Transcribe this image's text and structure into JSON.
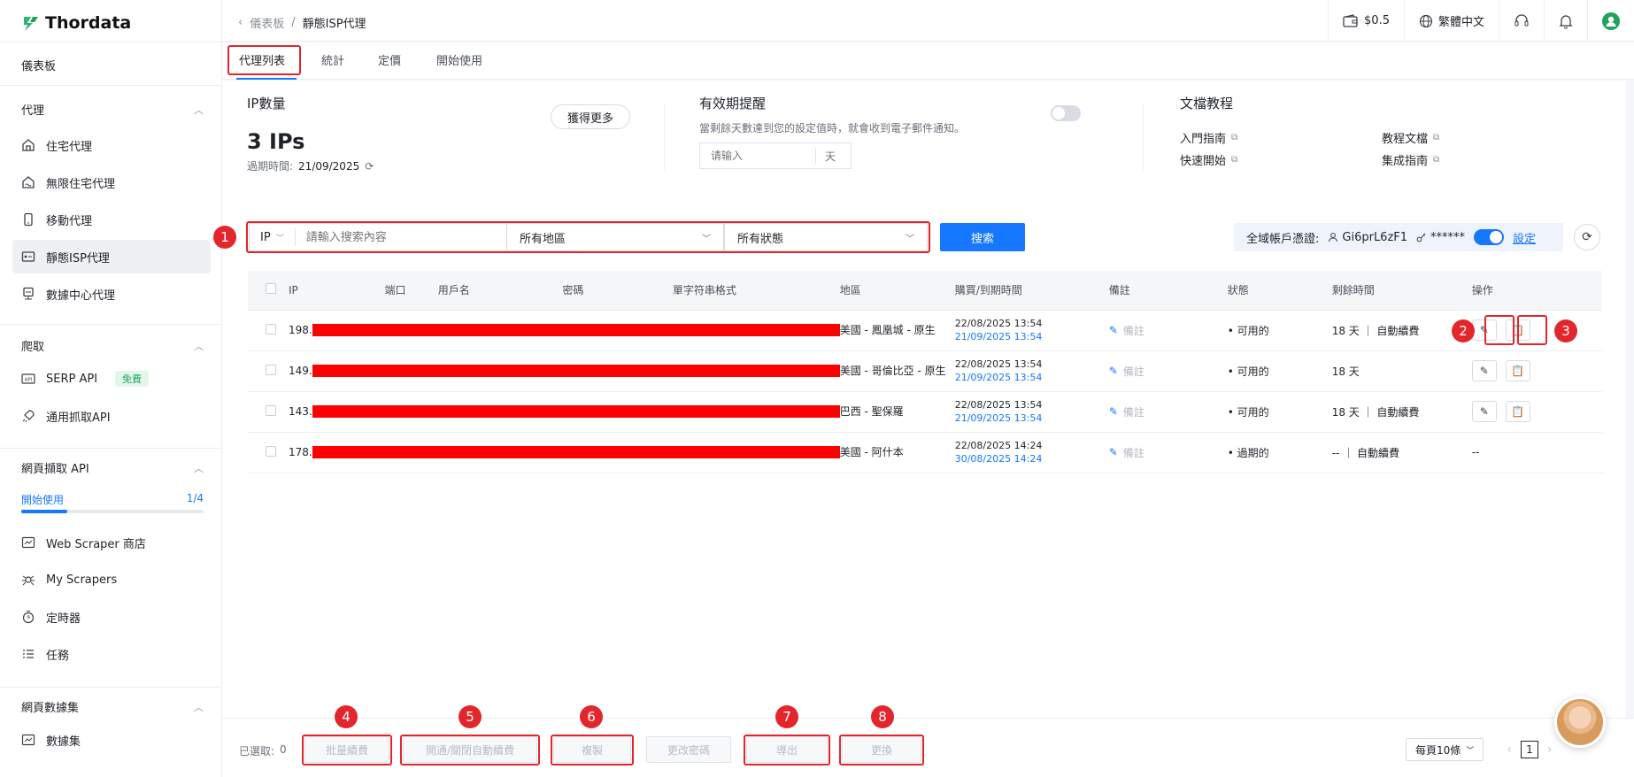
{
  "brand": {
    "name": "Thordata"
  },
  "sidebar": {
    "dashboard": "儀表板",
    "groups": [
      {
        "title": "代理",
        "items": [
          {
            "label": "住宅代理",
            "icon": "home-icon"
          },
          {
            "label": "無限住宅代理",
            "icon": "infinite-home-icon"
          },
          {
            "label": "移動代理",
            "icon": "mobile-icon"
          },
          {
            "label": "靜態ISP代理",
            "icon": "isp-icon",
            "active": true
          },
          {
            "label": "數據中心代理",
            "icon": "datacenter-icon"
          }
        ]
      },
      {
        "title": "爬取",
        "items": [
          {
            "label": "SERP API",
            "icon": "api-icon",
            "badge": "免費"
          },
          {
            "label": "通用抓取API",
            "icon": "rocket-icon"
          }
        ]
      },
      {
        "title": "網頁擷取 API",
        "progress": {
          "label": "開始使用",
          "count": "1/4",
          "fraction": 0.25
        },
        "items": [
          {
            "label": "Web Scraper 商店",
            "icon": "store-icon"
          },
          {
            "label": "My Scrapers",
            "icon": "spider-icon"
          },
          {
            "label": "定時器",
            "icon": "timer-icon"
          },
          {
            "label": "任務",
            "icon": "tasks-icon"
          }
        ]
      },
      {
        "title": "網頁數據集",
        "items": [
          {
            "label": "數據集",
            "icon": "dataset-icon"
          }
        ]
      }
    ]
  },
  "header": {
    "breadcrumb": [
      "儀表板",
      "/",
      "靜態ISP代理"
    ],
    "balance": "$0.5",
    "language": "繁體中文"
  },
  "tabs": [
    "代理列表",
    "統計",
    "定價",
    "開始使用"
  ],
  "summary": {
    "ip_count_title": "IP數量",
    "ip_count_value": "3 IPs",
    "expiry_label": "過期時間:",
    "expiry_value": "21/09/2025",
    "get_more": "獲得更多",
    "reminder_title": "有效期提醒",
    "reminder_desc": "當剩餘天數達到您的設定值時，就會收到電子郵件通知。",
    "reminder_placeholder": "请输入",
    "reminder_unit": "天",
    "docs_title": "文檔教程",
    "docs_links": [
      "入門指南",
      "教程文檔",
      "快速開始",
      "集成指南"
    ]
  },
  "filters": {
    "type": "IP",
    "search_placeholder": "請輸入搜索內容",
    "region": "所有地區",
    "status": "所有狀態",
    "search_button": "搜索",
    "cred_label": "全域帳戶憑證:",
    "cred_user": "Gi6prL6zF1",
    "cred_pass": "******",
    "cred_settings": "設定"
  },
  "table": {
    "columns": [
      "IP",
      "端口",
      "用戶名",
      "密碼",
      "單字符串格式",
      "地區",
      "購買/到期時間",
      "備註",
      "狀態",
      "剩餘時間",
      "操作"
    ],
    "note_label": "備註",
    "rows": [
      {
        "ip": "198.",
        "region": "美國 - 鳳凰城 - 原生",
        "bought": "22/08/2025 13:54",
        "expires": "21/09/2025 13:54",
        "status": "可用的",
        "status_type": "ok",
        "remaining": "18 天 ｜ 自動續費",
        "ops": true
      },
      {
        "ip": "149.",
        "region": "美國 - 哥倫比亞 - 原生",
        "bought": "22/08/2025 13:54",
        "expires": "21/09/2025 13:54",
        "status": "可用的",
        "status_type": "ok",
        "remaining": "18 天",
        "ops": true
      },
      {
        "ip": "143.",
        "region": "巴西 - 聖保羅",
        "bought": "22/08/2025 13:54",
        "expires": "21/09/2025 13:54",
        "status": "可用的",
        "status_type": "ok",
        "remaining": "18 天 ｜ 自動續費",
        "ops": true
      },
      {
        "ip": "178.",
        "region": "美國 - 阿什本",
        "bought": "22/08/2025 14:24",
        "expires": "30/08/2025 14:24",
        "status": "過期的",
        "status_type": "expired",
        "remaining": "-- ｜ 自動續費",
        "ops": false,
        "ops_text": "--"
      }
    ]
  },
  "footer": {
    "selected_label": "已選取:",
    "selected_count": "0",
    "buttons": [
      "批量續費",
      "開通/關閉自動續費",
      "複製",
      "更改密碼",
      "導出",
      "更換"
    ],
    "page_size": "每頁10條",
    "page": "1"
  },
  "annotations": [
    "1",
    "2",
    "3",
    "4",
    "5",
    "6",
    "7",
    "8"
  ],
  "colors": {
    "accent": "#1677ff",
    "annotation": "#e2262c",
    "ok": "#1fa35b",
    "expired": "#f07b1f"
  }
}
